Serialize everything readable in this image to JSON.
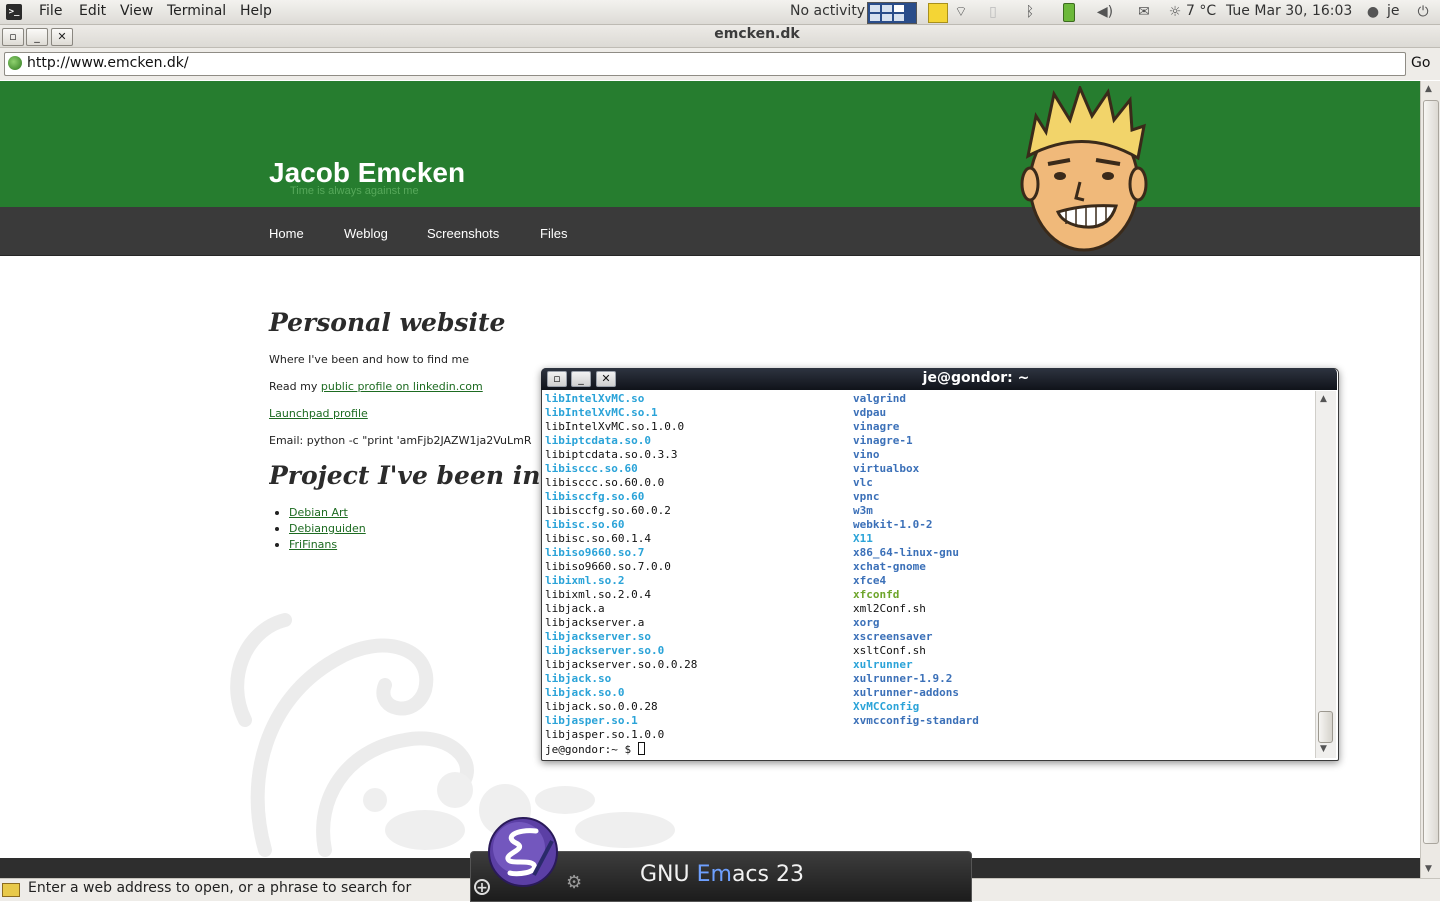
{
  "top_panel": {
    "menus": [
      "File",
      "Edit",
      "View",
      "Terminal",
      "Help"
    ],
    "activity": "No activity",
    "weather": "7 °C",
    "clock": "Tue Mar 30, 16:03",
    "user": "je",
    "icons": [
      "terminal-app-icon",
      "workspace-switcher-icon",
      "notes-icon",
      "wifi-icon",
      "battery-slot-icon",
      "bluetooth-icon",
      "battery-icon",
      "volume-icon",
      "mail-icon",
      "weather-icon",
      "chat-icon",
      "power-icon"
    ]
  },
  "window": {
    "title": "emcken.dk",
    "url": "http://www.emcken.dk/",
    "go_label": "Go",
    "status_text": "Enter a web address to open, or a phrase to search for"
  },
  "site": {
    "title": "Jacob Emcken",
    "tagline": "Time is always against me",
    "nav": [
      "Home",
      "Weblog",
      "Screenshots",
      "Files"
    ],
    "heading1": "Personal website",
    "intro": "Where I've been and how to find me",
    "linkedin_prefix": "Read my ",
    "linkedin_link": "public profile on linkedin.com",
    "launchpad_link": "Launchpad profile",
    "email_line": "Email: python -c \"print 'amFjb2JAZW1ja2VuLmR",
    "heading2": "Project I've been invol",
    "projects": [
      "Debian Art",
      "Debianguiden",
      "FriFinans"
    ],
    "colors": {
      "header_green": "#267d2f",
      "nav_dark": "#3a3a3a"
    }
  },
  "terminal": {
    "title": "je@gondor: ~",
    "col1": [
      {
        "t": "libIntelXvMC.so",
        "k": "link"
      },
      {
        "t": "libIntelXvMC.so.1",
        "k": "link"
      },
      {
        "t": "libIntelXvMC.so.1.0.0",
        "k": "plain"
      },
      {
        "t": "libiptcdata.so.0",
        "k": "link"
      },
      {
        "t": "libiptcdata.so.0.3.3",
        "k": "plain"
      },
      {
        "t": "libisccc.so.60",
        "k": "link"
      },
      {
        "t": "libisccc.so.60.0.0",
        "k": "plain"
      },
      {
        "t": "libisccfg.so.60",
        "k": "link"
      },
      {
        "t": "libisccfg.so.60.0.2",
        "k": "plain"
      },
      {
        "t": "libisc.so.60",
        "k": "link"
      },
      {
        "t": "libisc.so.60.1.4",
        "k": "plain"
      },
      {
        "t": "libiso9660.so.7",
        "k": "link"
      },
      {
        "t": "libiso9660.so.7.0.0",
        "k": "plain"
      },
      {
        "t": "libixml.so.2",
        "k": "link"
      },
      {
        "t": "libixml.so.2.0.4",
        "k": "plain"
      },
      {
        "t": "libjack.a",
        "k": "plain"
      },
      {
        "t": "libjackserver.a",
        "k": "plain"
      },
      {
        "t": "libjackserver.so",
        "k": "link"
      },
      {
        "t": "libjackserver.so.0",
        "k": "link"
      },
      {
        "t": "libjackserver.so.0.0.28",
        "k": "plain"
      },
      {
        "t": "libjack.so",
        "k": "link"
      },
      {
        "t": "libjack.so.0",
        "k": "link"
      },
      {
        "t": "libjack.so.0.0.28",
        "k": "plain"
      },
      {
        "t": "libjasper.so.1",
        "k": "link"
      },
      {
        "t": "libjasper.so.1.0.0",
        "k": "plain"
      }
    ],
    "col2": [
      {
        "t": "valgrind",
        "k": "dir"
      },
      {
        "t": "vdpau",
        "k": "dir"
      },
      {
        "t": "vinagre",
        "k": "dir"
      },
      {
        "t": "vinagre-1",
        "k": "dir"
      },
      {
        "t": "vino",
        "k": "dir"
      },
      {
        "t": "virtualbox",
        "k": "dir"
      },
      {
        "t": "vlc",
        "k": "dir"
      },
      {
        "t": "vpnc",
        "k": "dir"
      },
      {
        "t": "w3m",
        "k": "dir"
      },
      {
        "t": "webkit-1.0-2",
        "k": "dir"
      },
      {
        "t": "X11",
        "k": "link"
      },
      {
        "t": "x86_64-linux-gnu",
        "k": "dir"
      },
      {
        "t": "xchat-gnome",
        "k": "dir"
      },
      {
        "t": "xfce4",
        "k": "dir"
      },
      {
        "t": "xfconfd",
        "k": "exec"
      },
      {
        "t": "xml2Conf.sh",
        "k": "plain"
      },
      {
        "t": "xorg",
        "k": "dir"
      },
      {
        "t": "xscreensaver",
        "k": "dir"
      },
      {
        "t": "xsltConf.sh",
        "k": "plain"
      },
      {
        "t": "xulrunner",
        "k": "link"
      },
      {
        "t": "xulrunner-1.9.2",
        "k": "dir"
      },
      {
        "t": "xulrunner-addons",
        "k": "dir"
      },
      {
        "t": "XvMCConfig",
        "k": "link"
      },
      {
        "t": "xvmcconfig-standard",
        "k": "dir"
      }
    ],
    "prompt": "je@gondor:~ $ "
  },
  "dock": {
    "label_pre": "GNU ",
    "label_em": "Em",
    "label_post": "acs 23"
  }
}
